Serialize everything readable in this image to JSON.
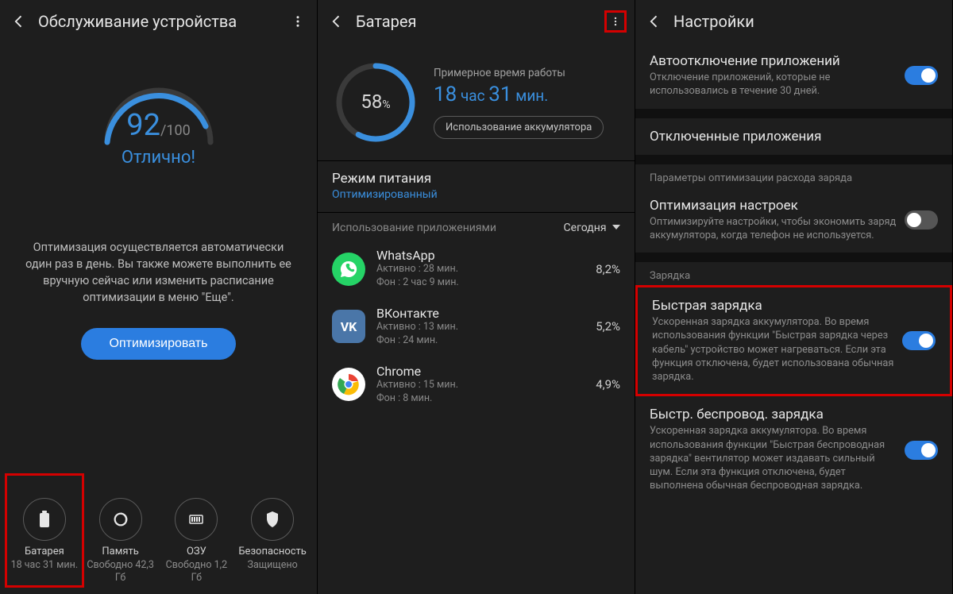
{
  "panel1": {
    "title": "Обслуживание устройства",
    "score": "92",
    "score_max": "/100",
    "status": "Отлично!",
    "description": "Оптимизация осуществляется автоматически один раз в день. Вы также можете выполнить ее вручную сейчас или изменить расписание оптимизации в меню \"Еще\".",
    "optimize_btn": "Оптимизировать",
    "bottom": [
      {
        "label": "Батарея",
        "sub": "18 час 31 мин."
      },
      {
        "label": "Память",
        "sub": "Свободно 42,3 Гб"
      },
      {
        "label": "ОЗУ",
        "sub": "Свободно 1,2 Гб"
      },
      {
        "label": "Безопасность",
        "sub": "Защищено"
      }
    ]
  },
  "panel2": {
    "title": "Батарея",
    "percent": "58",
    "percent_unit": "%",
    "est_label": "Примерное время работы",
    "est_h": "18",
    "est_h_unit": "час",
    "est_m": "31",
    "est_m_unit": "мин.",
    "usage_btn": "Использование аккумулятора",
    "power_mode_title": "Режим питания",
    "power_mode_value": "Оптимизированный",
    "usage_header_l": "Использование приложениями",
    "usage_header_r": "Сегодня",
    "apps": [
      {
        "name": "WhatsApp",
        "active": "Активно : 28 мин.",
        "bg": "Фон : 2 час 9 мин.",
        "pct": "8,2%"
      },
      {
        "name": "ВКонтакте",
        "active": "Активно : 13 мин.",
        "bg": "Фон : 24 мин.",
        "pct": "5,2%"
      },
      {
        "name": "Chrome",
        "active": "Активно : 15 мин.",
        "bg": "Фон : 8 мин.",
        "pct": "4,9%"
      }
    ]
  },
  "panel3": {
    "title": "Настройки",
    "auto_off_title": "Автоотключение приложений",
    "auto_off_desc": "Отключение приложений, которые не использовались в течение 30 дней.",
    "disabled_apps": "Отключенные приложения",
    "opt_section": "Параметры оптимизации расхода заряда",
    "opt_title": "Оптимизация настроек",
    "opt_desc": "Оптимизируйте настройки, чтобы экономить заряд аккумулятора, когда телефон не используется.",
    "charge_section": "Зарядка",
    "fast_title": "Быстрая зарядка",
    "fast_desc": "Ускоренная зарядка аккумулятора. Во время использования функции \"Быстрая зарядка через кабель\" устройство может нагреваться. Если эта функция отключена, будет использована обычная зарядка.",
    "wireless_title": "Быстр. беспровод. зарядка",
    "wireless_desc": "Ускоренная зарядка аккумулятора. Во время использования функции \"Быстрая беспроводная зарядка\" вентилятор может издавать сильный шум. Если эта функция отключена, будет выполнена обычная беспроводная зарядка."
  }
}
